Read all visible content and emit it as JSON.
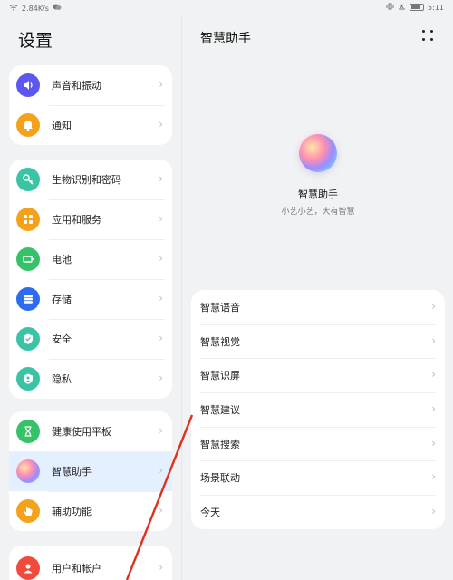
{
  "status": {
    "speed": "2.84K/s",
    "time": "5:11"
  },
  "left": {
    "title": "设置",
    "groups": [
      {
        "items": [
          {
            "label": "声音和振动",
            "icon": "volume-icon",
            "color": "#5b57f0",
            "glyph": "♪"
          },
          {
            "label": "通知",
            "icon": "bell-icon",
            "color": "#f4a21b",
            "glyph": "♫"
          }
        ]
      },
      {
        "items": [
          {
            "label": "生物识别和密码",
            "icon": "key-icon",
            "color": "#39c4a6",
            "glyph": "⚿"
          },
          {
            "label": "应用和服务",
            "icon": "apps-icon",
            "color": "#f4a21b",
            "glyph": "▦"
          },
          {
            "label": "电池",
            "icon": "battery-icon",
            "color": "#37c26a",
            "glyph": "▭"
          },
          {
            "label": "存储",
            "icon": "storage-icon",
            "color": "#2d6cf0",
            "glyph": "☰"
          },
          {
            "label": "安全",
            "icon": "shield-icon",
            "color": "#39c4a6",
            "glyph": "⛉"
          },
          {
            "label": "隐私",
            "icon": "privacy-icon",
            "color": "#39c4a6",
            "glyph": "☻"
          }
        ]
      },
      {
        "items": [
          {
            "label": "健康使用平板",
            "icon": "hourglass-icon",
            "color": "#37c26a",
            "glyph": "⧗"
          },
          {
            "label": "智慧助手",
            "icon": "assistant-icon",
            "color": "#b28cff",
            "glyph": "●"
          },
          {
            "label": "辅助功能",
            "icon": "hand-icon",
            "color": "#f4a21b",
            "glyph": "☝"
          }
        ]
      },
      {
        "items": [
          {
            "label": "用户和帐户",
            "icon": "user-icon",
            "color": "#ef4a3a",
            "glyph": "☺"
          }
        ]
      }
    ]
  },
  "right": {
    "title": "智慧助手",
    "assistant_name": "智慧助手",
    "assistant_sub": "小艺小艺，大有智慧",
    "features": [
      "智慧语音",
      "智慧视觉",
      "智慧识屏",
      "智慧建议",
      "智慧搜索",
      "场景联动",
      "今天"
    ]
  }
}
